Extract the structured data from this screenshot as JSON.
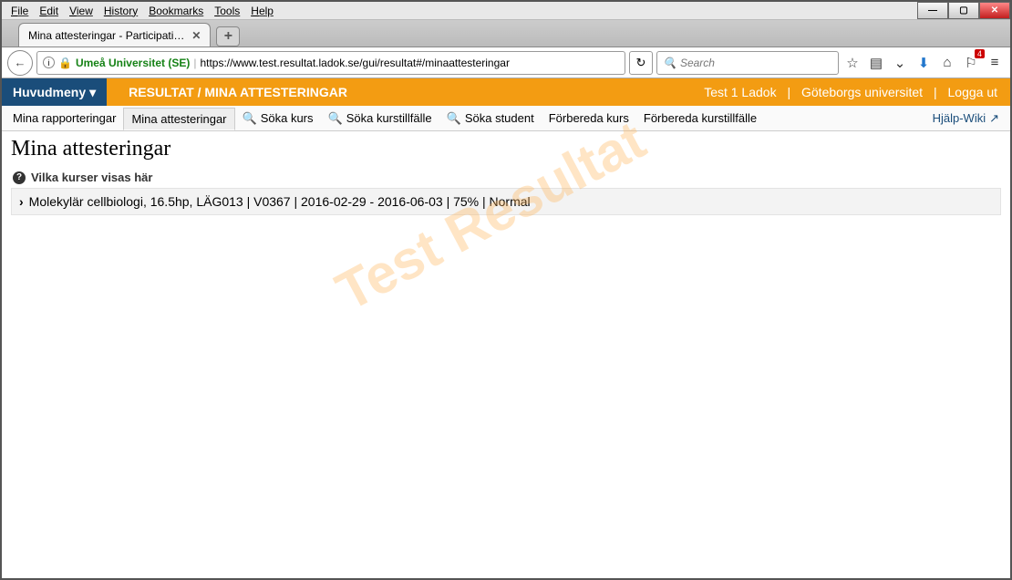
{
  "menubar": [
    "File",
    "Edit",
    "View",
    "History",
    "Bookmarks",
    "Tools",
    "Help"
  ],
  "tab": {
    "title": "Mina attesteringar - Participati…"
  },
  "url": {
    "identity": "Umeå Universitet (SE)",
    "path": "https://www.test.resultat.ladok.se/gui/resultat#/minaattesteringar"
  },
  "search": {
    "placeholder": "Search"
  },
  "notif_count": "4",
  "huvudmeny": "Huvudmeny",
  "breadcrumb": "RESULTAT / MINA ATTESTERINGAR",
  "user": "Test 1 Ladok",
  "org": "Göteborgs universitet",
  "logout": "Logga ut",
  "subnav": {
    "rapport": "Mina rapporteringar",
    "attest": "Mina attesteringar",
    "sok_kurs": "Söka kurs",
    "sok_tillf": "Söka kurstillfälle",
    "sok_student": "Söka student",
    "forb_kurs": "Förbereda kurs",
    "forb_tillf": "Förbereda kurstillfälle",
    "hjalp": "Hjälp-Wiki"
  },
  "page": {
    "heading": "Mina attesteringar",
    "helpline": "Vilka kurser visas här",
    "course": "Molekylär cellbiologi, 16.5hp, LÄG013 | V0367 | 2016-02-29 - 2016-06-03 | 75% | Normal"
  },
  "watermark": "Test Resultat"
}
